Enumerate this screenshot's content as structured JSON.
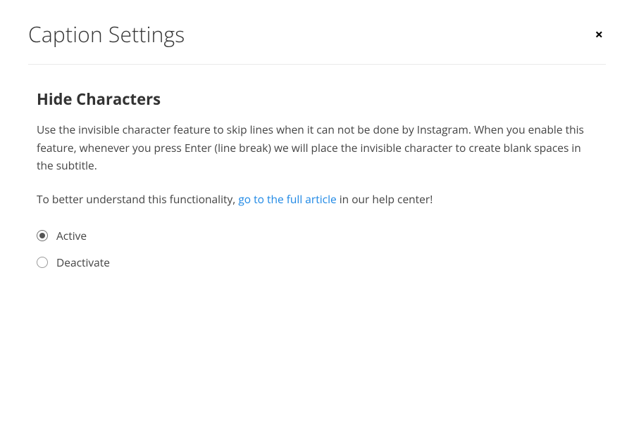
{
  "header": {
    "title": "Caption Settings",
    "close_label": "×"
  },
  "section": {
    "heading": "Hide Characters",
    "description": "Use the invisible character feature to skip lines when it can not be done by Instagram. When you enable this feature, whenever you press Enter (line break) we will place the invisible character to create blank spaces in the subtitle.",
    "help_prefix": "To better understand this functionality, ",
    "help_link": "go to the full article",
    "help_suffix": " in our help center!"
  },
  "options": {
    "active_label": "Active",
    "deactivate_label": "Deactivate",
    "selected": "active"
  }
}
